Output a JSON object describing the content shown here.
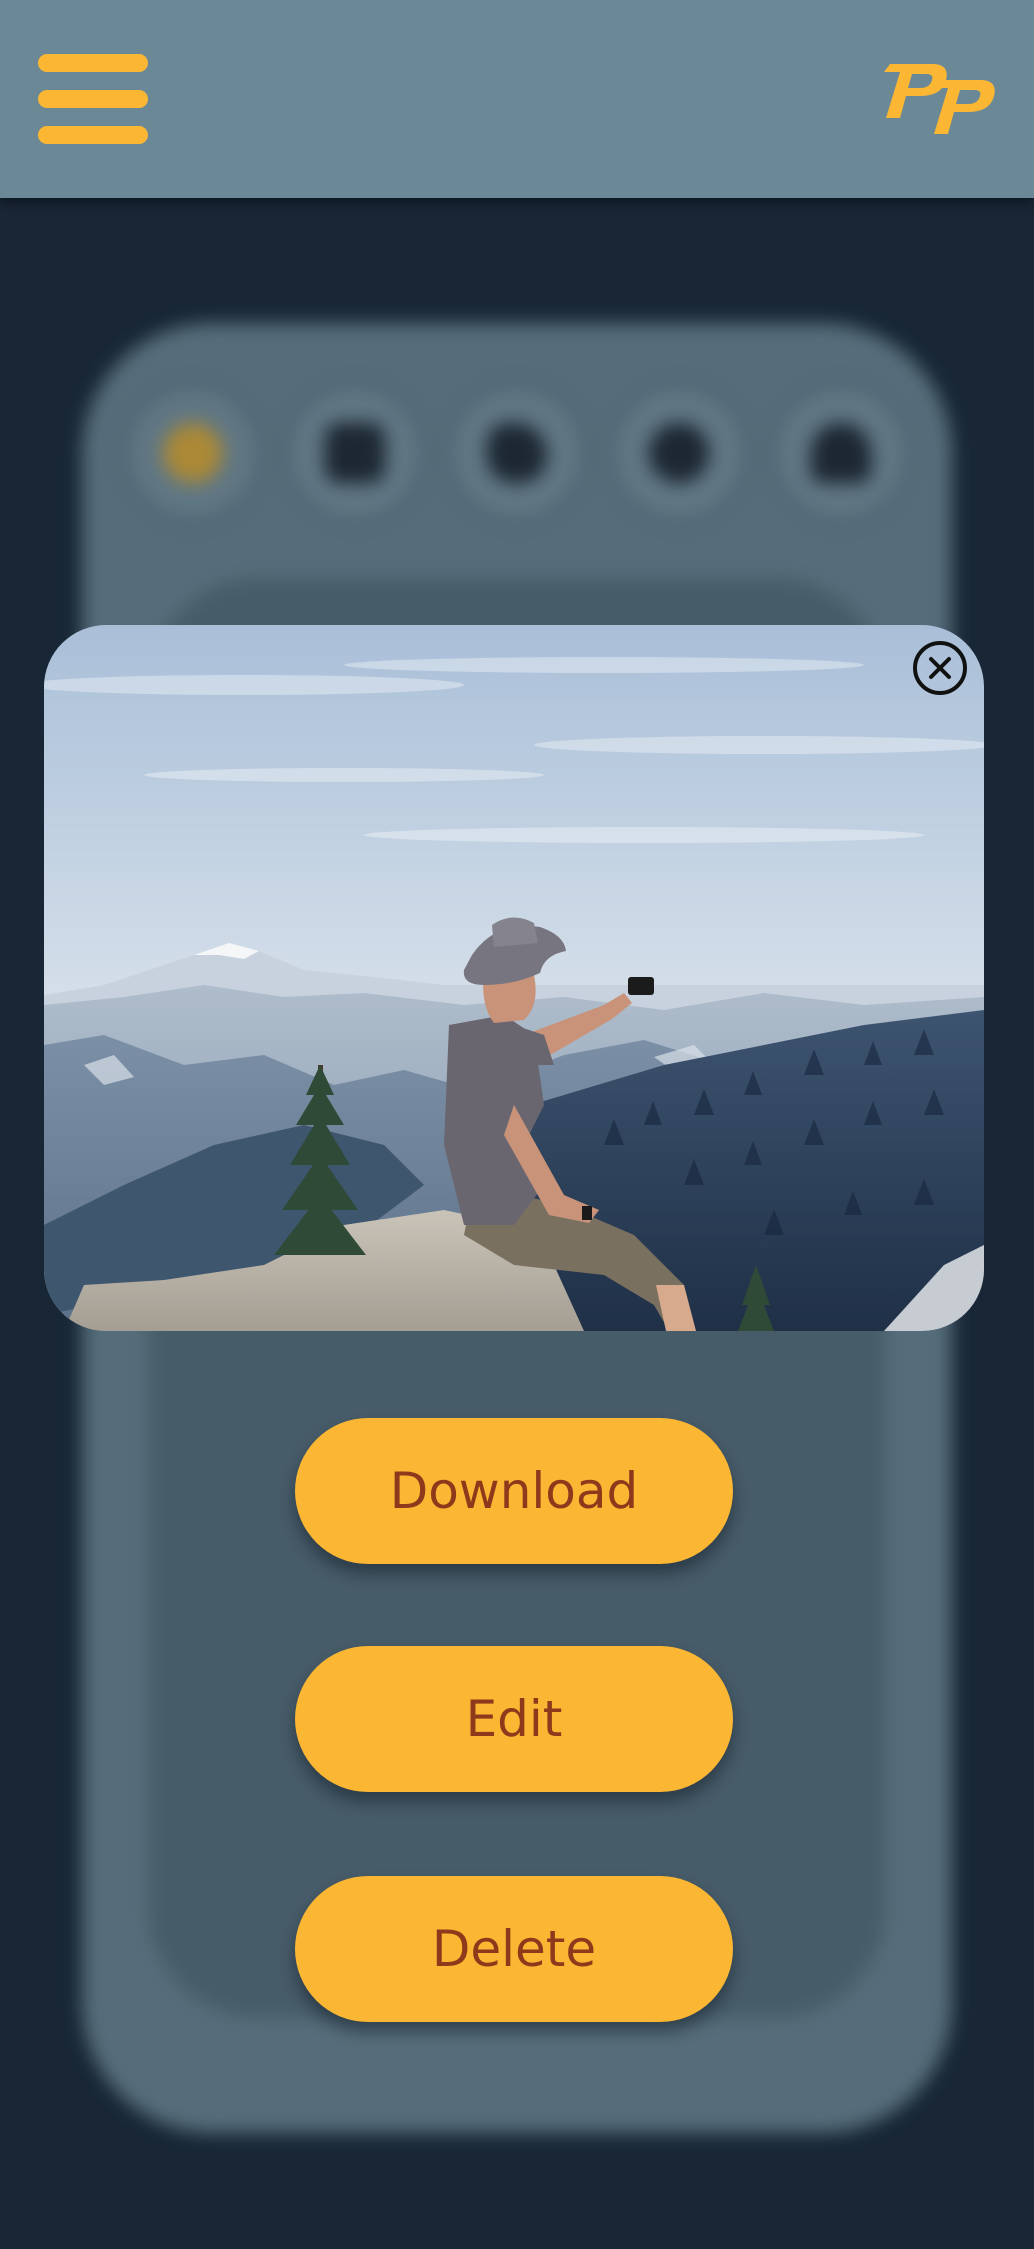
{
  "header": {
    "menu_icon": "hamburger-menu-icon",
    "logo_icon": "pp-logo-icon"
  },
  "background": {
    "social_icons": [
      "info-icon",
      "instagram-icon",
      "twitter-icon",
      "messenger-icon",
      "cloud-upload-icon"
    ]
  },
  "modal": {
    "photo_subject": "hiker taking selfie on mountain",
    "close_icon": "close-icon",
    "actions": {
      "download_label": "Download",
      "edit_label": "Edit",
      "delete_label": "Delete"
    }
  },
  "colors": {
    "accent": "#fbb733",
    "button_text": "#8c3a1b",
    "header_bg": "#6b8896",
    "page_bg": "#1a293a"
  }
}
